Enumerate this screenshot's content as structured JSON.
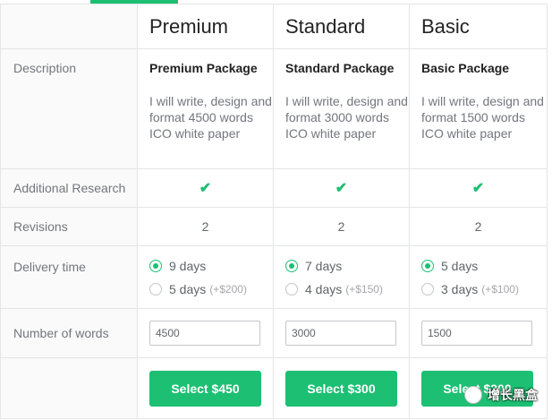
{
  "colors": {
    "accent": "#1dbf73",
    "border": "#e4e5e7"
  },
  "packages": [
    {
      "name": "Premium",
      "desc_title": "Premium Package",
      "desc_text": "I will write, design and format 4500 words ICO white paper",
      "research": "check",
      "revisions": "2",
      "delivery": [
        {
          "label": "9 days",
          "extra": "",
          "selected": true
        },
        {
          "label": "5 days",
          "extra": "(+$200)",
          "selected": false
        }
      ],
      "words": "4500",
      "button": "Select $450"
    },
    {
      "name": "Standard",
      "desc_title": "Standard Package",
      "desc_text": "I will write, design and format 3000 words ICO white paper",
      "research": "check",
      "revisions": "2",
      "delivery": [
        {
          "label": "7 days",
          "extra": "",
          "selected": true
        },
        {
          "label": "4 days",
          "extra": "(+$150)",
          "selected": false
        }
      ],
      "words": "3000",
      "button": "Select $300"
    },
    {
      "name": "Basic",
      "desc_title": "Basic Package",
      "desc_text": "I will write, design and format 1500 words ICO white paper",
      "research": "check",
      "revisions": "2",
      "delivery": [
        {
          "label": "5 days",
          "extra": "",
          "selected": true
        },
        {
          "label": "3 days",
          "extra": "(+$100)",
          "selected": false
        }
      ],
      "words": "1500",
      "button": "Select $200"
    }
  ],
  "rows": {
    "description": "Description",
    "research": "Additional Research",
    "revisions": "Revisions",
    "delivery": "Delivery time",
    "words": "Number of words"
  },
  "watermark": {
    "text": "增长黑盒"
  }
}
